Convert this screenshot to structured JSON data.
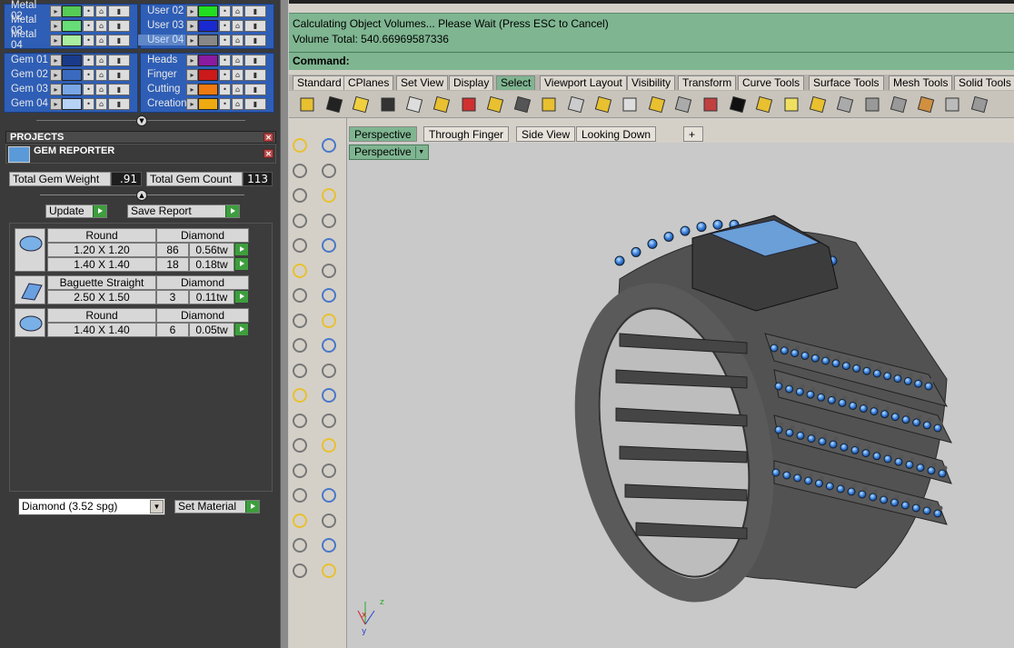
{
  "layers": {
    "metals": [
      {
        "label": "Metal 02",
        "color": "#55cc55"
      },
      {
        "label": "Metal 03",
        "color": "#66dd77"
      },
      {
        "label": "Metal 04",
        "color": "#aaeea0"
      }
    ],
    "users": [
      {
        "label": "User 02",
        "color": "#22dd22"
      },
      {
        "label": "User 03",
        "color": "#1a2ad0"
      },
      {
        "label": "User 04",
        "color": "#888888",
        "selected": true
      }
    ],
    "gems": [
      {
        "label": "Gem 01",
        "color": "#1a3a8a"
      },
      {
        "label": "Gem 02",
        "color": "#3a6ac0"
      },
      {
        "label": "Gem 03",
        "color": "#7aa6e8"
      },
      {
        "label": "Gem 04",
        "color": "#b6d2f4"
      }
    ],
    "other": [
      {
        "label": "Heads",
        "color": "#8a1aa0"
      },
      {
        "label": "Finger",
        "color": "#cc1a1a"
      },
      {
        "label": "Cutting",
        "color": "#ee7a10"
      },
      {
        "label": "Creation",
        "color": "#eeaa10"
      }
    ]
  },
  "projects": {
    "title": "PROJECTS"
  },
  "gem_reporter": {
    "title": "GEM REPORTER",
    "total_weight_label": "Total Gem Weight",
    "total_weight_value": ".91",
    "total_count_label": "Total Gem Count",
    "total_count_value": "113",
    "update_label": "Update",
    "save_report_label": "Save Report",
    "groups": [
      {
        "shape": "Round",
        "material": "Diamond",
        "rows": [
          {
            "size": "1.20 X 1.20",
            "count": "86",
            "weight": "0.56tw"
          },
          {
            "size": "1.40 X 1.40",
            "count": "18",
            "weight": "0.18tw"
          }
        ]
      },
      {
        "shape": "Baguette Straight",
        "material": "Diamond",
        "rows": [
          {
            "size": "2.50 X 1.50",
            "count": "3",
            "weight": "0.11tw"
          }
        ]
      },
      {
        "shape": "Round",
        "material": "Diamond",
        "rows": [
          {
            "size": "1.40 X 1.40",
            "count": "6",
            "weight": "0.05tw"
          }
        ]
      }
    ],
    "material_select": "Diamond      (3.52 spg)",
    "set_material_label": "Set Material"
  },
  "command": {
    "line1": "Calculating Object Volumes... Please Wait (Press ESC to Cancel)",
    "line2": "Volume Total: 540.66969587336",
    "prompt": "Command:"
  },
  "toolbar_tabs": [
    "Standard",
    "CPlanes",
    "Set View",
    "Display",
    "Select",
    "Viewport Layout",
    "Visibility",
    "Transform",
    "Curve Tools",
    "Surface Tools",
    "Mesh Tools",
    "Solid Tools"
  ],
  "toolbar_active": "Select",
  "viewport_tabs": [
    "Perspective",
    "Through Finger",
    "Side View",
    "Looking Down"
  ],
  "viewport_tab_add": "+",
  "viewport_label": "Perspective",
  "axis": {
    "x": "x",
    "y": "y",
    "z": "z"
  },
  "colors": {
    "command_bg": "#7fb591",
    "panel_bg": "#3a3a3a",
    "layer_blue": "#2e5eb6"
  }
}
